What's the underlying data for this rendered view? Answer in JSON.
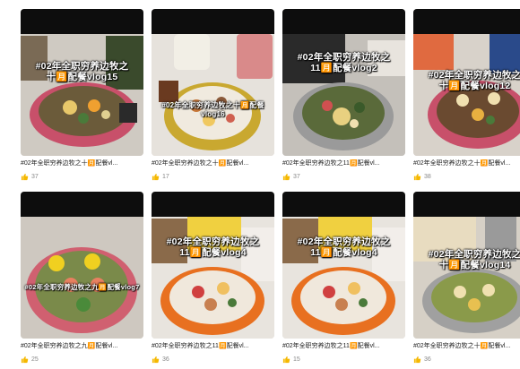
{
  "videos": [
    {
      "overlay_line1": "#02年全职穷养边牧之",
      "overlay_line2": "十🈷️配餐vlog15",
      "title": "#02年全职穷养边牧之十🈷️配餐vl...",
      "likes": "37"
    },
    {
      "overlay_line1": "#02年全职穷养边牧之十🈷️配餐vlog16",
      "overlay_line2": "",
      "title": "#02年全职穷养边牧之十🈷️配餐vl...",
      "likes": "17"
    },
    {
      "overlay_line1": "#02年全职穷养边牧之",
      "overlay_line2": "11🈷️配餐vlog2",
      "title": "#02年全职穷养边牧之11🈷️配餐vl...",
      "likes": "37"
    },
    {
      "overlay_line1": "#02年全职穷养边牧之",
      "overlay_line2": "十🈷️配餐vlog12",
      "title": "#02年全职穷养边牧之十🈷️配餐vl...",
      "likes": "38"
    },
    {
      "overlay_line1": "#02年全职穷养边牧之九🈷️配餐vlog7",
      "overlay_line2": "",
      "title": "#02年全职穷养边牧之九🈷️配餐vl...",
      "likes": "25"
    },
    {
      "overlay_line1": "#02年全职穷养边牧之",
      "overlay_line2": "11🈷️配餐vlog4",
      "title": "#02年全职穷养边牧之11🈷️配餐vl...",
      "likes": "36"
    },
    {
      "overlay_line1": "#02年全职穷养边牧之",
      "overlay_line2": "11🈷️配餐vlog4",
      "title": "#02年全职穷养边牧之11🈷️配餐vl...",
      "likes": "15"
    },
    {
      "overlay_line1": "#02年全职穷养边牧之",
      "overlay_line2": "十🈷️配餐vlog14",
      "title": "#02年全职穷养边牧之十🈷️配餐vl...",
      "likes": "36"
    }
  ],
  "colors": {
    "overlay_text": "#ffffff",
    "topbar": "#0d0d0d",
    "like_icon": "#f5b800"
  },
  "icons": {
    "like": "thumbs-up-icon"
  }
}
